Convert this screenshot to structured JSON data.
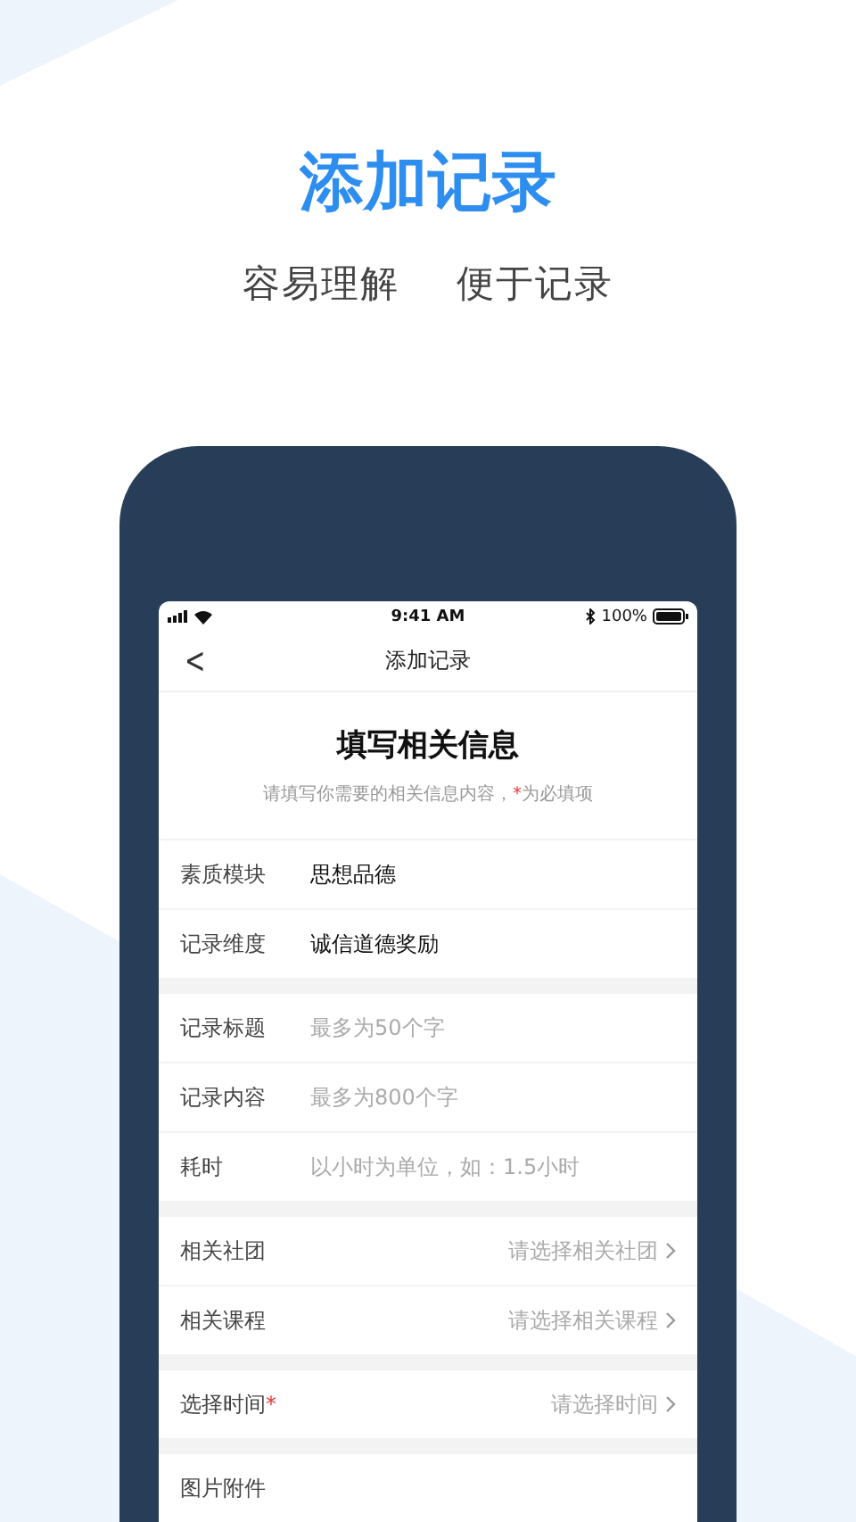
{
  "headline": "添加记录",
  "taglines": [
    "容易理解",
    "便于记录"
  ],
  "status_bar": {
    "time": "9:41 AM",
    "battery": "100%"
  },
  "nav": {
    "back": "<",
    "title": "添加记录"
  },
  "form_header": {
    "title": "填写相关信息",
    "hint_before": "请填写你需要的相关信息内容，",
    "hint_mark": "*",
    "hint_after": "为必填项"
  },
  "groups": [
    {
      "rows": [
        {
          "kind": "value",
          "label": "素质模块",
          "value": "思想品德"
        },
        {
          "kind": "value",
          "label": "记录维度",
          "value": "诚信道德奖励"
        }
      ]
    },
    {
      "rows": [
        {
          "kind": "input",
          "label": "记录标题",
          "placeholder": "最多为50个字"
        },
        {
          "kind": "input",
          "label": "记录内容",
          "placeholder": "最多为800个字"
        },
        {
          "kind": "input",
          "label": "耗时",
          "placeholder": "以小时为单位，如：1.5小时"
        }
      ]
    },
    {
      "rows": [
        {
          "kind": "select",
          "label": "相关社团",
          "placeholder": "请选择相关社团"
        },
        {
          "kind": "select",
          "label": "相关课程",
          "placeholder": "请选择相关课程"
        }
      ]
    },
    {
      "rows": [
        {
          "kind": "select",
          "label": "选择时间",
          "required_mark": "*",
          "placeholder": "请选择时间"
        }
      ]
    },
    {
      "rows": [
        {
          "kind": "value",
          "label": "图片附件"
        }
      ]
    }
  ]
}
